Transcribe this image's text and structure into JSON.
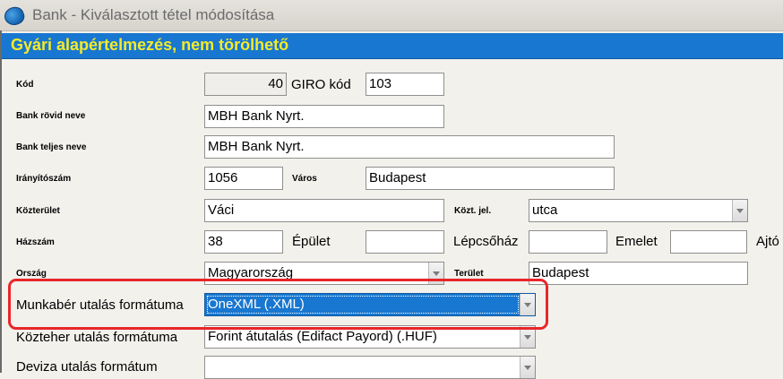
{
  "window": {
    "title": "Bank - Kiválasztott tétel módosítása"
  },
  "banner": {
    "text": "Gyári alapértelmezés, nem törölhető"
  },
  "form": {
    "kod": {
      "label": "Kód",
      "value": "40"
    },
    "giro": {
      "label": "GIRO kód",
      "value": "103"
    },
    "rovid": {
      "label": "Bank rövid neve",
      "value": "MBH Bank Nyrt."
    },
    "teljes": {
      "label": "Bank teljes neve",
      "value": "MBH Bank Nyrt."
    },
    "irsz": {
      "label": "Irányítószám",
      "value": "1056"
    },
    "varos": {
      "label": "Város",
      "value": "Budapest"
    },
    "kozterulet": {
      "label": "Közterület",
      "value": "Váci"
    },
    "kozt_jel": {
      "label": "Közt. jel.",
      "value": "utca"
    },
    "hazszam": {
      "label": "Házszám",
      "value": "38"
    },
    "epulet": {
      "label": "Épület",
      "value": ""
    },
    "lepcsohaz": {
      "label": "Lépcsőház",
      "value": ""
    },
    "emelet": {
      "label": "Emelet",
      "value": ""
    },
    "ajto": {
      "label": "Ajtó",
      "value": ""
    },
    "orszag": {
      "label": "Ország",
      "value": "Magyarország"
    },
    "terulet": {
      "label": "Terület",
      "value": "Budapest"
    },
    "munkaber": {
      "label": "Munkabér utalás formátuma",
      "value": "OneXML (.XML)"
    },
    "kozteher": {
      "label": "Közteher utalás formátuma",
      "value": "Forint átutalás (Edifact Payord) (.HUF)"
    },
    "deviza": {
      "label": "Deviza utalás formátum",
      "value": ""
    }
  }
}
